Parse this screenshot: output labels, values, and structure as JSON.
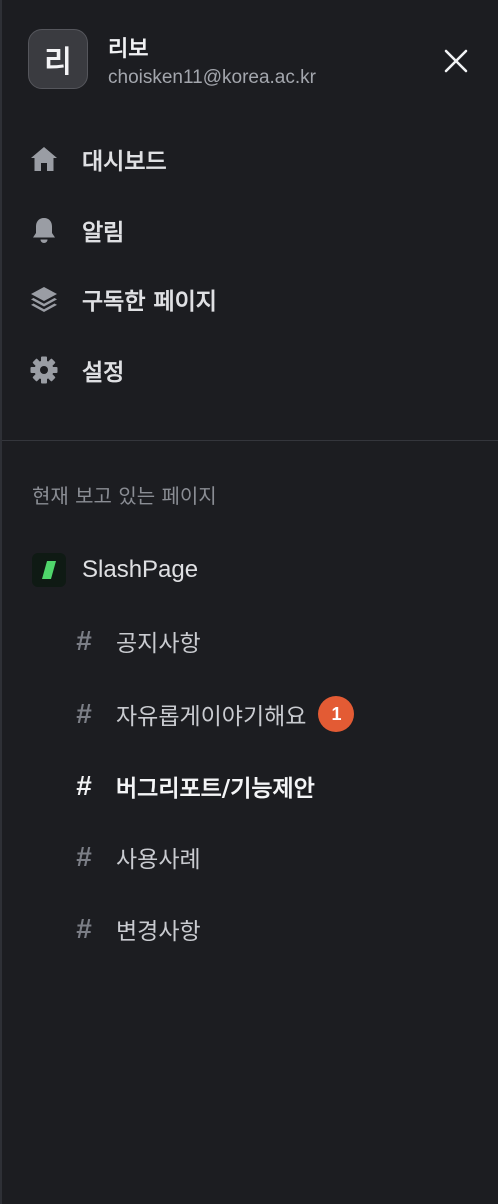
{
  "user": {
    "avatar_text": "리",
    "name": "리보",
    "email": "choisken11@korea.ac.kr"
  },
  "nav": [
    {
      "label": "대시보드",
      "icon": "home-icon"
    },
    {
      "label": "알림",
      "icon": "bell-icon"
    },
    {
      "label": "구독한 페이지",
      "icon": "layers-icon"
    },
    {
      "label": "설정",
      "icon": "gear-icon"
    }
  ],
  "section_title": "현재 보고 있는 페이지",
  "space": {
    "name": "SlashPage",
    "logo_color": "#4fd66b"
  },
  "channels": [
    {
      "label": "공지사항",
      "active": false
    },
    {
      "label": "자유롭게이야기해요",
      "active": false,
      "badge": "1"
    },
    {
      "label": "버그리포트/기능제안",
      "active": true
    },
    {
      "label": "사용사례",
      "active": false
    },
    {
      "label": "변경사항",
      "active": false
    }
  ],
  "hash_symbol": "#",
  "colors": {
    "background": "#1c1d21",
    "badge": "#e35b34",
    "accent_logo": "#4fd66b"
  }
}
